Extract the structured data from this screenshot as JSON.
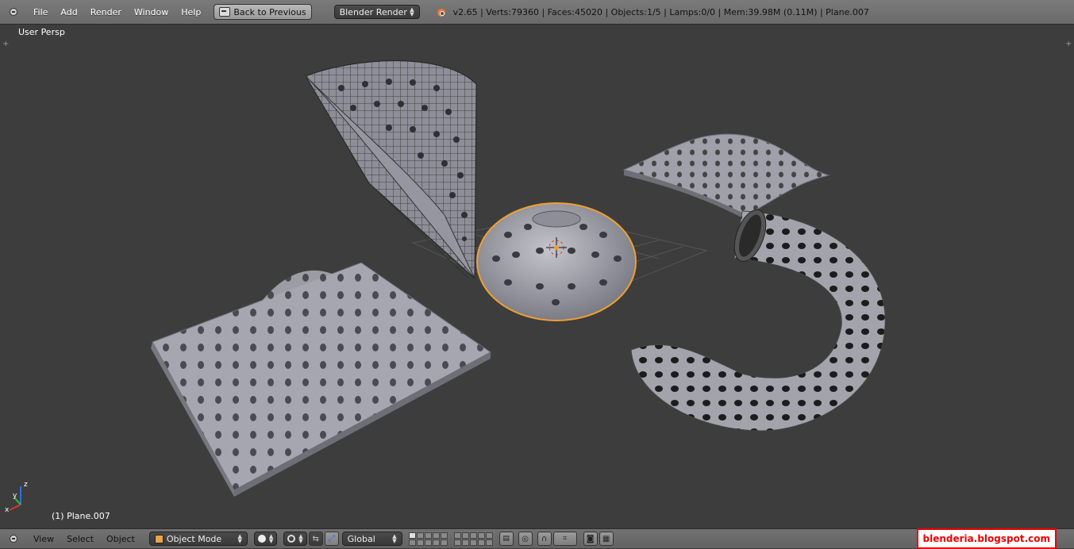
{
  "header": {
    "menu": [
      "File",
      "Add",
      "Render",
      "Window",
      "Help"
    ],
    "back_label": "Back to Previous",
    "render_engine": "Blender Render",
    "stats": "v2.65 | Verts:79360 | Faces:45020 | Objects:1/5 | Lamps:0/0 | Mem:39.98M (0.11M) | Plane.007"
  },
  "viewport": {
    "view_name": "User Persp",
    "active_object": "(1) Plane.007",
    "axis_labels": {
      "x": "x",
      "y": "y",
      "z": "z"
    }
  },
  "footer": {
    "menu": [
      "View",
      "Select",
      "Object"
    ],
    "mode": "Object Mode",
    "orientation": "Global"
  },
  "watermark": "blenderia.blogspot.com",
  "colors": {
    "background": "#3d3d3d",
    "header": "#727272",
    "mesh": "#a9a9b3",
    "selection_outline": "#f0a030",
    "grid": "#5a5a5a",
    "watermark_red": "#e00000"
  }
}
